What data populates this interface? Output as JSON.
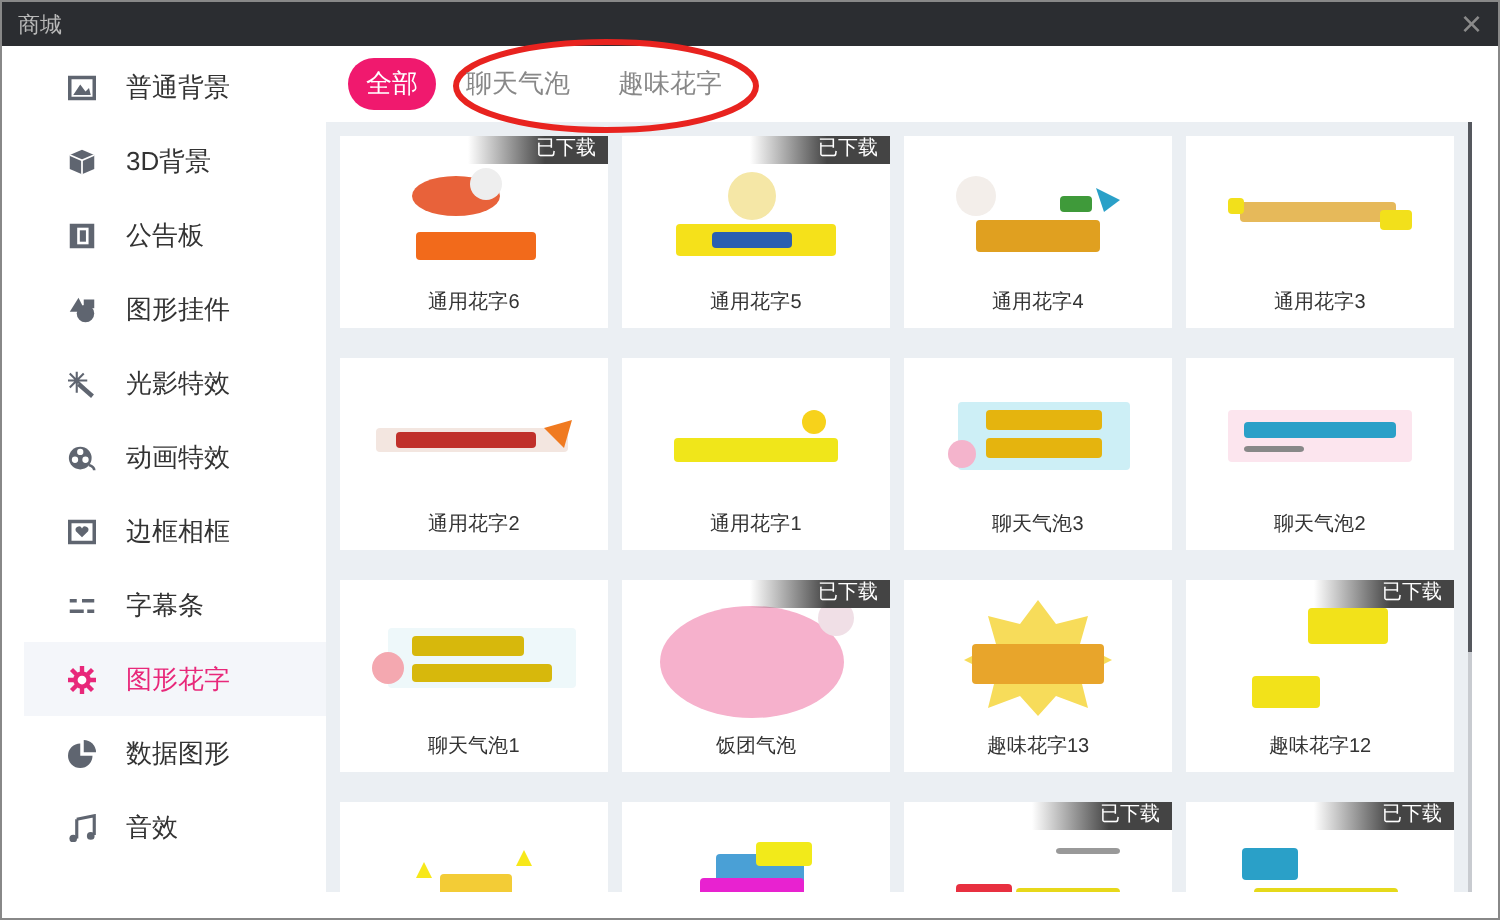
{
  "window": {
    "title": "商城",
    "close": "×"
  },
  "sidebar": {
    "items": [
      {
        "label": "普通背景",
        "selected": false
      },
      {
        "label": "3D背景",
        "selected": false
      },
      {
        "label": "公告板",
        "selected": false
      },
      {
        "label": "图形挂件",
        "selected": false
      },
      {
        "label": "光影特效",
        "selected": false
      },
      {
        "label": "动画特效",
        "selected": false
      },
      {
        "label": "边框相框",
        "selected": false
      },
      {
        "label": "字幕条",
        "selected": false
      },
      {
        "label": "图形花字",
        "selected": true
      },
      {
        "label": "数据图形",
        "selected": false
      },
      {
        "label": "音效",
        "selected": false
      }
    ]
  },
  "tabs": [
    {
      "label": "全部",
      "selected": true
    },
    {
      "label": "聊天气泡",
      "selected": false
    },
    {
      "label": "趣味花字",
      "selected": false
    }
  ],
  "annotation": {
    "kind": "ellipse",
    "color": "#e8231f"
  },
  "cards": [
    {
      "kind": "sticker",
      "label": "通用花字6",
      "badge": "已下载"
    },
    {
      "kind": "sticker",
      "label": "通用花字5",
      "badge": "已下载"
    },
    {
      "kind": "sticker",
      "label": "通用花字4"
    },
    {
      "kind": "sticker",
      "label": "通用花字3"
    },
    {
      "kind": "sticker",
      "label": "通用花字2"
    },
    {
      "kind": "sticker",
      "label": "通用花字1"
    },
    {
      "kind": "sticker",
      "label": "聊天气泡3"
    },
    {
      "kind": "sticker",
      "label": "聊天气泡2"
    },
    {
      "kind": "sticker",
      "label": "聊天气泡1"
    },
    {
      "kind": "sticker",
      "label": "饭团气泡",
      "badge": "已下载"
    },
    {
      "kind": "sticker",
      "label": "趣味花字13"
    },
    {
      "kind": "sticker",
      "label": "趣味花字12",
      "badge": "已下载"
    },
    {
      "kind": "sticker"
    },
    {
      "kind": "sticker"
    },
    {
      "kind": "sticker",
      "badge": "已下载"
    },
    {
      "kind": "sticker",
      "badge": "已下载"
    }
  ]
}
